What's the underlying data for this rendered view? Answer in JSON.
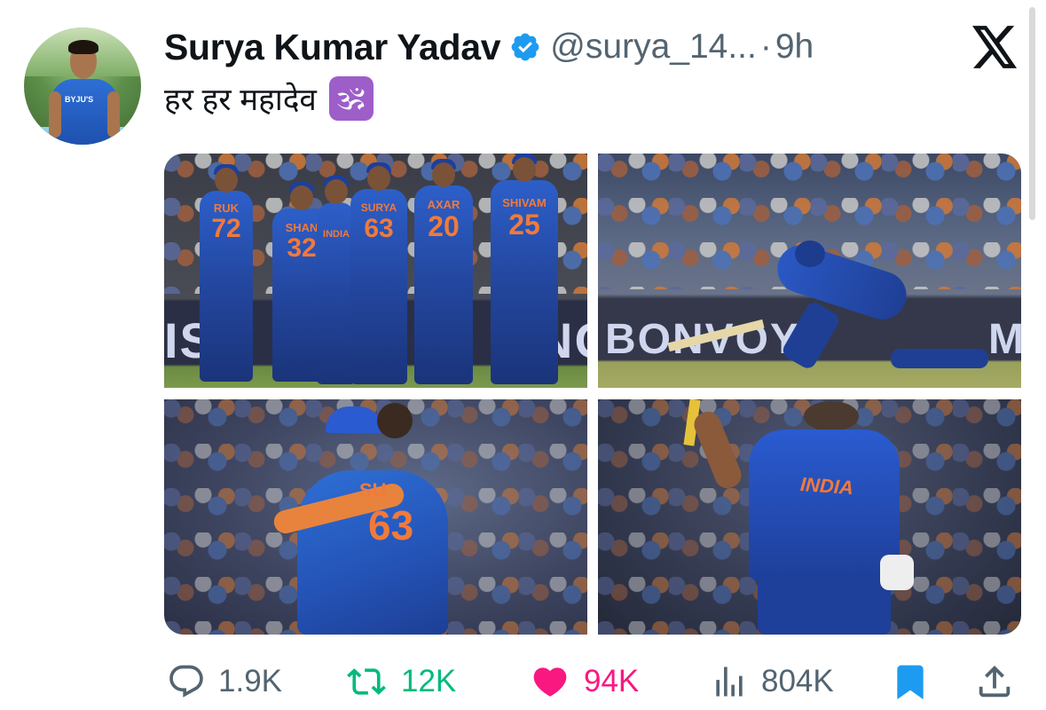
{
  "author": {
    "name": "Surya Kumar Yadav",
    "handle": "@surya_14...",
    "separator": "·",
    "time": "9h",
    "avatar_jersey_text": "BYJU'S"
  },
  "icons": {
    "verified": "verified-badge-icon",
    "x_logo": "x-logo-icon",
    "reply": "reply-icon",
    "retweet": "retweet-icon",
    "like": "heart-icon",
    "views": "views-icon",
    "bookmark": "bookmark-icon",
    "share": "share-icon"
  },
  "tweet": {
    "text": "हर हर महादेव",
    "emoji": "🕉"
  },
  "media": {
    "photo1": {
      "board_text": "IS",
      "board_text_right": "NG",
      "jerseys": [
        {
          "name": "RUK",
          "number": "72"
        },
        {
          "name": "SHAN",
          "number": "32"
        },
        {
          "name": "",
          "number": "INDIA"
        },
        {
          "name": "SURYA",
          "number": "63"
        },
        {
          "name": "AXAR",
          "number": "20"
        },
        {
          "name": "SHIVAM",
          "number": "25"
        }
      ]
    },
    "photo2": {
      "board_text": "BONVOY",
      "board_text_right": "M"
    },
    "photo3": {
      "jersey_name": "SU",
      "jersey_number": "63"
    },
    "photo4": {
      "jersey_text": "INDIA"
    }
  },
  "stats": {
    "replies": "1.9K",
    "retweets": "12K",
    "likes": "94K",
    "views": "804K"
  },
  "colors": {
    "text": "#0f1419",
    "secondary": "#536471",
    "verified": "#1d9bf0",
    "retweet": "#00ba7c",
    "like": "#f91880",
    "bookmark": "#1d9bf0",
    "om_badge": "#9d5ec9"
  }
}
